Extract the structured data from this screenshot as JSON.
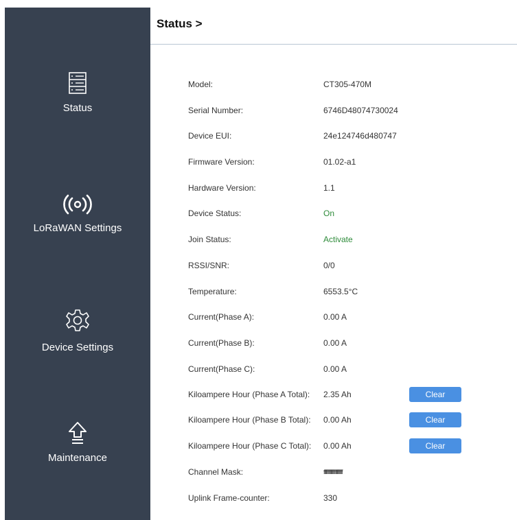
{
  "header": {
    "title": "Status >"
  },
  "sidebar": {
    "items": [
      {
        "label": "Status",
        "icon": "status-icon"
      },
      {
        "label": "LoRaWAN Settings",
        "icon": "signal-icon"
      },
      {
        "label": "Device Settings",
        "icon": "gear-icon"
      },
      {
        "label": "Maintenance",
        "icon": "maintenance-icon"
      }
    ]
  },
  "status": {
    "rows": [
      {
        "key": "Model:",
        "value": "CT305-470M"
      },
      {
        "key": "Serial Number:",
        "value": "6746D48074730024"
      },
      {
        "key": "Device EUI:",
        "value": "24e124746d480747"
      },
      {
        "key": "Firmware Version:",
        "value": "01.02-a1"
      },
      {
        "key": "Hardware Version:",
        "value": "1.1"
      },
      {
        "key": "Device Status:",
        "value": "On"
      },
      {
        "key": "Join Status:",
        "value": "Activate"
      },
      {
        "key": "RSSI/SNR:",
        "value": "0/0"
      },
      {
        "key": "Temperature:",
        "value": "6553.5°C"
      },
      {
        "key": "Current(Phase A):",
        "value": "0.00 A"
      },
      {
        "key": "Current(Phase B):",
        "value": "0.00 A"
      },
      {
        "key": "Current(Phase C):",
        "value": "0.00 A"
      },
      {
        "key": "Kiloampere Hour (Phase A Total):",
        "value": "2.35 Ah"
      },
      {
        "key": "Kiloampere Hour (Phase B Total):",
        "value": "0.00 Ah"
      },
      {
        "key": "Kiloampere Hour (Phase C Total):",
        "value": "0.00 Ah"
      },
      {
        "key": "Channel Mask:",
        "value": "ffffffffffffffffffffffff"
      },
      {
        "key": "Uplink Frame-counter:",
        "value": "330"
      }
    ],
    "clear_label": "Clear"
  },
  "colors": {
    "sidebar_bg": "#374150",
    "accent_button": "#4a90e2",
    "status_ok": "#2e8b3a",
    "header_divider": "#b9c6d3"
  }
}
